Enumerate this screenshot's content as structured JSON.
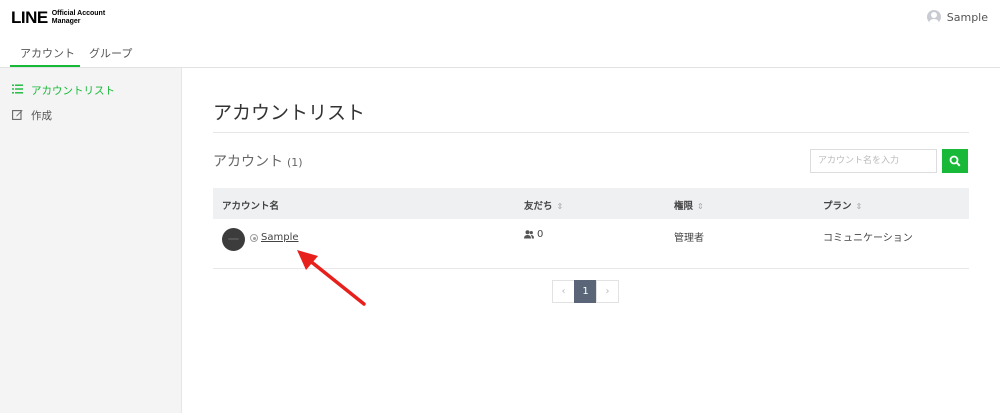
{
  "header": {
    "logo_main": "LINE",
    "logo_sub": "Official Account Manager",
    "user_name": "Sample"
  },
  "tabs": [
    {
      "label": "アカウント",
      "active": true
    },
    {
      "label": "グループ",
      "active": false
    }
  ],
  "sidebar": {
    "items": [
      {
        "label": "アカウントリスト",
        "icon": "list-icon",
        "active": true
      },
      {
        "label": "作成",
        "icon": "edit-icon",
        "active": false
      }
    ]
  },
  "main": {
    "title": "アカウントリスト",
    "section_title": "アカウント",
    "section_count": "(1)",
    "search": {
      "placeholder": "アカウント名を入力",
      "value": ""
    },
    "table": {
      "columns": [
        {
          "label": "アカウント名",
          "sortable": false
        },
        {
          "label": "友だち",
          "sortable": true
        },
        {
          "label": "権限",
          "sortable": true
        },
        {
          "label": "プラン",
          "sortable": true
        }
      ],
      "rows": [
        {
          "name": "Sample",
          "friends": "0",
          "role": "管理者",
          "plan": "コミュニケーション"
        }
      ]
    },
    "pagination": {
      "prev": "‹",
      "current": "1",
      "next": "›"
    }
  },
  "colors": {
    "accent": "#18b839",
    "pager_active": "#5a6677",
    "annotation_arrow": "#e8201c"
  }
}
